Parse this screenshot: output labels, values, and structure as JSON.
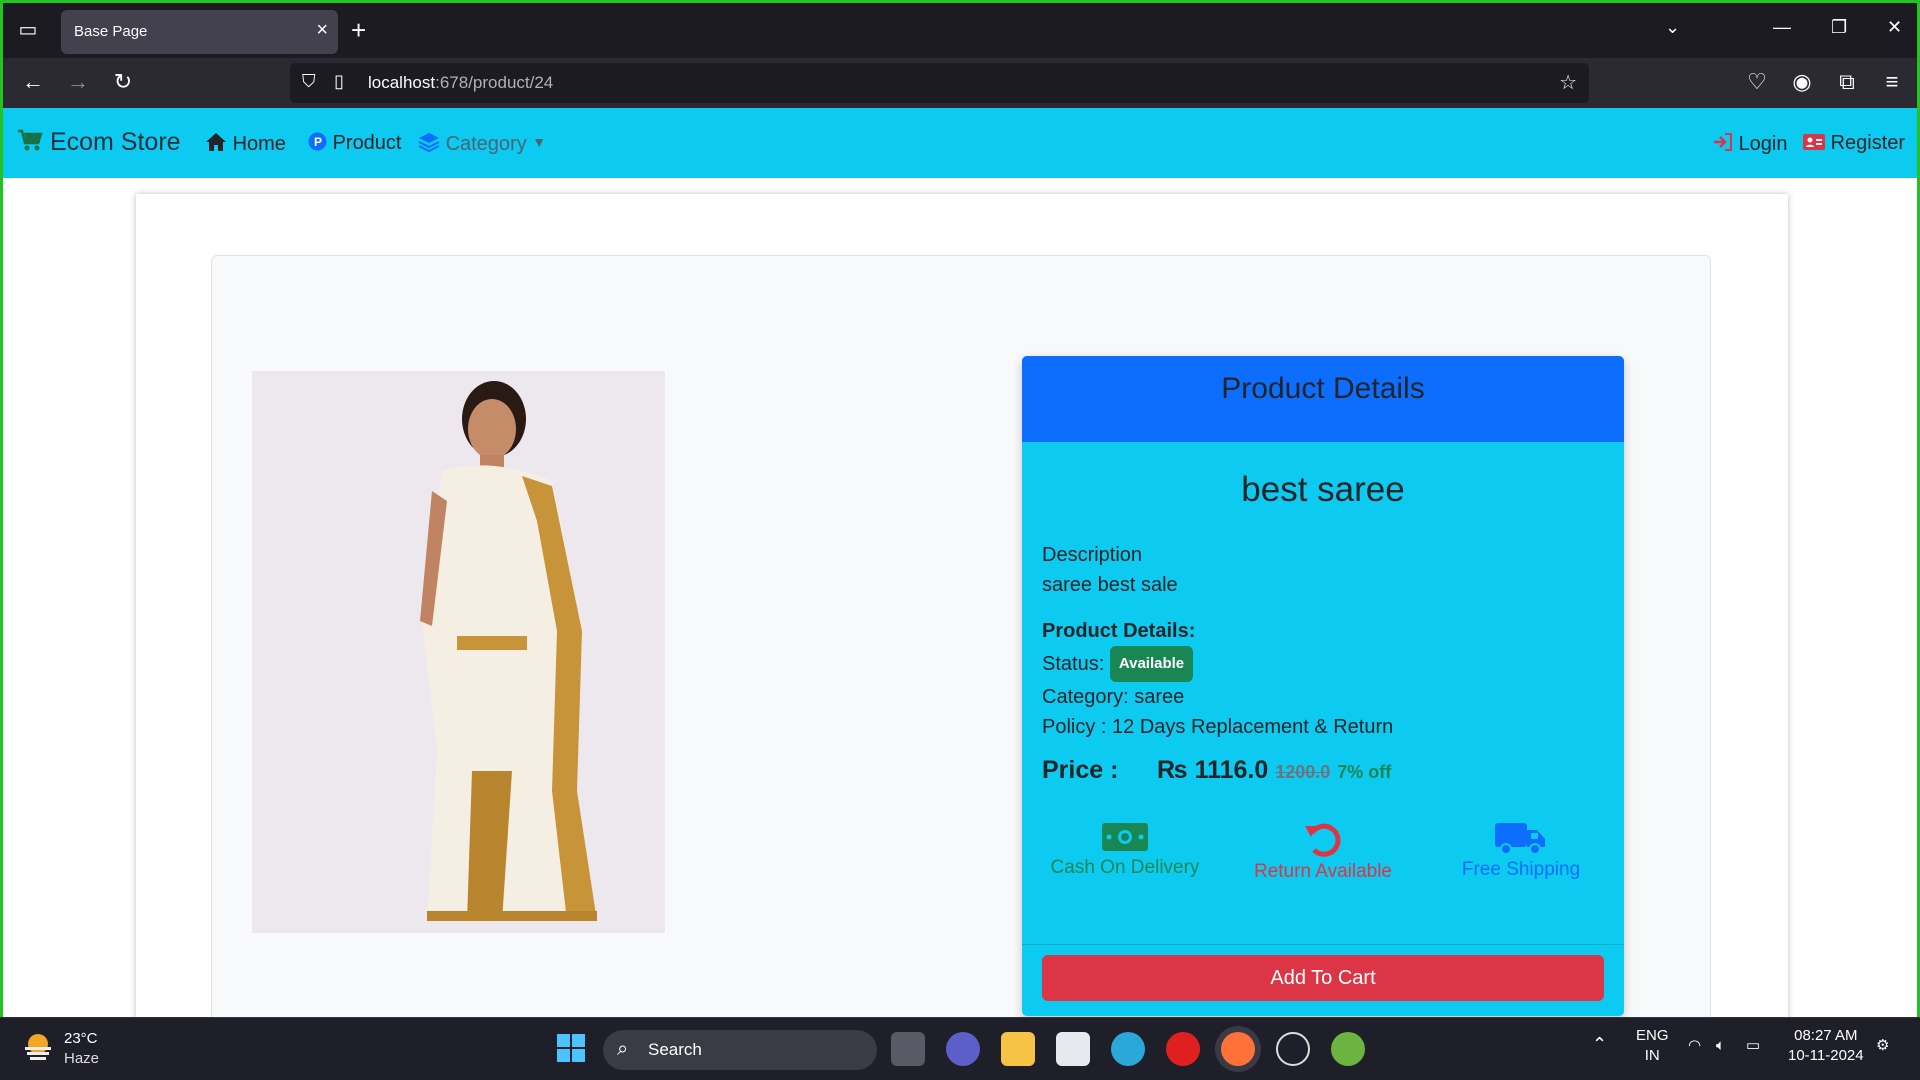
{
  "browser": {
    "tab_title": "Base Page",
    "url_host": "localhost",
    "url_path": ":678/product/24"
  },
  "site_nav": {
    "brand": "Ecom Store",
    "home": "Home",
    "product": "Product",
    "category": "Category",
    "login": "Login",
    "register": "Register"
  },
  "product": {
    "card_title": "Product Details",
    "name": "best saree",
    "description_label": "Description",
    "description": "saree best sale",
    "details_label": "Product Details:",
    "status_label": "Status:",
    "status_badge": "Available",
    "category_line": "Category: saree",
    "policy_line": "Policy : 12 Days Replacement & Return",
    "price_label": "Price :",
    "price": "₨ 1116.0",
    "old_price": "1200.0",
    "discount": "7% off",
    "features": [
      {
        "label": "Cash On Delivery",
        "icon": "money-icon",
        "color": "#198754"
      },
      {
        "label": "Return Available",
        "icon": "undo-icon",
        "color": "#dc3545"
      },
      {
        "label": "Free Shipping",
        "icon": "truck-icon",
        "color": "#0d6efd"
      }
    ],
    "add_to_cart": "Add To Cart"
  },
  "taskbar": {
    "temperature": "23°C",
    "condition": "Haze",
    "search_placeholder": "Search",
    "lang1": "ENG",
    "lang2": "IN",
    "time": "08:27 AM",
    "date": "10-11-2024"
  }
}
